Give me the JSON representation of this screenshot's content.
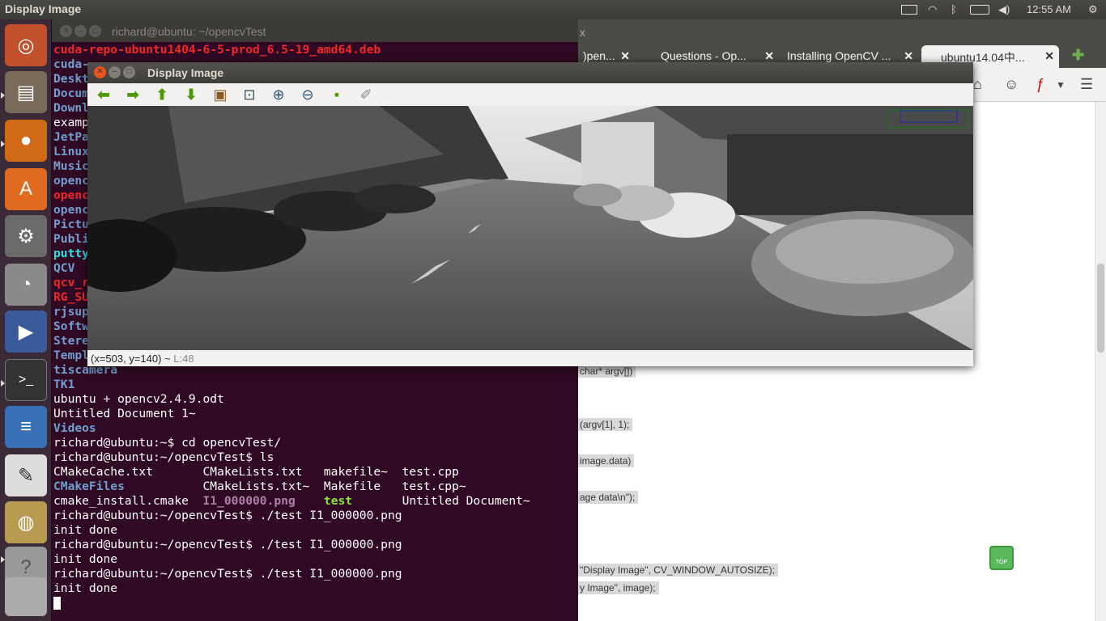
{
  "top_panel": {
    "active_app": "Display Image",
    "clock": "12:55 AM"
  },
  "terminal": {
    "title": "richard@ubuntu: ~/opencvTest",
    "lines": [
      [
        {
          "t": "cuda-repo-ubuntu1404-6-5-prod_6.5-19_amd64.deb",
          "c": "red"
        }
      ],
      [
        {
          "t": "cuda-",
          "c": "blue"
        }
      ],
      [
        {
          "t": "Deskt",
          "c": "blue"
        }
      ],
      [
        {
          "t": "Docum",
          "c": "blue"
        }
      ],
      [
        {
          "t": "Downl",
          "c": "blue"
        }
      ],
      [
        {
          "t": "examp",
          "c": ""
        }
      ],
      [
        {
          "t": "JetPa",
          "c": "blue"
        }
      ],
      [
        {
          "t": "Linux",
          "c": "blue"
        }
      ],
      [
        {
          "t": "Music",
          "c": "blue"
        }
      ],
      [
        {
          "t": "openc",
          "c": "blue"
        }
      ],
      [
        {
          "t": "openc",
          "c": "red"
        }
      ],
      [
        {
          "t": "openc",
          "c": "blue"
        }
      ],
      [
        {
          "t": "Pictu",
          "c": "blue"
        }
      ],
      [
        {
          "t": "Publi",
          "c": "blue"
        }
      ],
      [
        {
          "t": "putty",
          "c": "cyan"
        }
      ],
      [
        {
          "t": "QCV",
          "c": "blue"
        }
      ],
      [
        {
          "t": "qcv_r",
          "c": "red"
        }
      ],
      [
        {
          "t": "RG_SU",
          "c": "red"
        }
      ],
      [
        {
          "t": "rjsup",
          "c": "blue"
        }
      ],
      [
        {
          "t": "Softw",
          "c": "blue"
        }
      ],
      [
        {
          "t": "Stere",
          "c": "blue"
        }
      ],
      [
        {
          "t": "Templ",
          "c": "blue"
        }
      ],
      [
        {
          "t": "tiscamera",
          "c": "blue"
        }
      ],
      [
        {
          "t": "TK1",
          "c": "blue"
        }
      ],
      [
        {
          "t": "ubuntu + opencv2.4.9.odt",
          "c": ""
        }
      ],
      [
        {
          "t": "Untitled Document 1~",
          "c": ""
        }
      ],
      [
        {
          "t": "Videos",
          "c": "blue"
        }
      ],
      [
        {
          "t": "richard@ubuntu:~$ cd opencvTest/",
          "c": ""
        }
      ],
      [
        {
          "t": "richard@ubuntu:~/opencvTest$ ls",
          "c": ""
        }
      ],
      [
        {
          "t": "CMakeCache.txt       CMakeLists.txt   makefile~  test.cpp",
          "c": ""
        }
      ],
      [
        {
          "t": "CMakeFiles",
          "c": "blue"
        },
        {
          "t": "           CMakeLists.txt~  Makefile   test.cpp~",
          "c": ""
        }
      ],
      [
        {
          "t": "cmake_install.cmake  ",
          "c": ""
        },
        {
          "t": "I1_000000.png",
          "c": "magenta"
        },
        {
          "t": "    ",
          "c": ""
        },
        {
          "t": "test",
          "c": "green"
        },
        {
          "t": "       Untitled Document~",
          "c": ""
        }
      ],
      [
        {
          "t": "richard@ubuntu:~/opencvTest$ ./test I1_000000.png",
          "c": ""
        }
      ],
      [
        {
          "t": "init done",
          "c": ""
        }
      ],
      [
        {
          "t": "richard@ubuntu:~/opencvTest$ ./test I1_000000.png",
          "c": ""
        }
      ],
      [
        {
          "t": "init done",
          "c": ""
        }
      ],
      [
        {
          "t": "richard@ubuntu:~/opencvTest$ ./test I1_000000.png",
          "c": ""
        }
      ],
      [
        {
          "t": "init done",
          "c": ""
        }
      ]
    ]
  },
  "browser": {
    "title_fragment": "x",
    "tabs": [
      {
        "label": ")pen..."
      },
      {
        "label": "Questions - Op..."
      },
      {
        "label": "Installing OpenCV ..."
      },
      {
        "label": "ubuntu14.04中..."
      }
    ],
    "code_lines": [
      "char* argv[])",
      "(argv[1], 1);",
      "image.data)",
      "age data\\n\");",
      "\"Display Image\", CV_WINDOW_AUTOSIZE);",
      "y Image\", image);"
    ],
    "top_button": "TOP"
  },
  "display_window": {
    "title": "Display Image",
    "status_coords": "(x=503, y=140) ~ ",
    "status_level": "L:48"
  }
}
